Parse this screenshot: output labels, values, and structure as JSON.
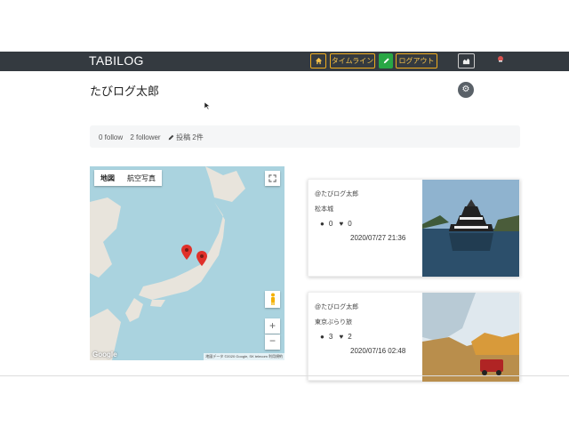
{
  "brand": "TABILOG",
  "nav": {
    "home_icon": "home-icon",
    "timeline": "タイムライン",
    "pencil_icon": "pencil-icon",
    "logout": "ログアウト",
    "map_icon": "map-icon",
    "bell_icon": "bell-icon"
  },
  "profile": {
    "name": "たびログ太郎",
    "follow": "0 follow",
    "follower": "2 follower",
    "posts": "投稿 2件"
  },
  "map": {
    "tab_map": "地図",
    "tab_satellite": "航空写真",
    "google": "Google",
    "attribution": "地図データ ©2020 Google, SK telecom   利用規約"
  },
  "posts": [
    {
      "author": "@たびログ太郎",
      "title": "松本城",
      "comments": "0",
      "likes": "0",
      "date": "2020/07/27 21:36"
    },
    {
      "author": "@たびログ太郎",
      "title": "東京ぶらり旅",
      "comments": "3",
      "likes": "2",
      "date": "2020/07/16 02:48"
    }
  ],
  "colors": {
    "navbar": "#343a40",
    "accent": "#f0ad1e",
    "green": "#28a745"
  }
}
